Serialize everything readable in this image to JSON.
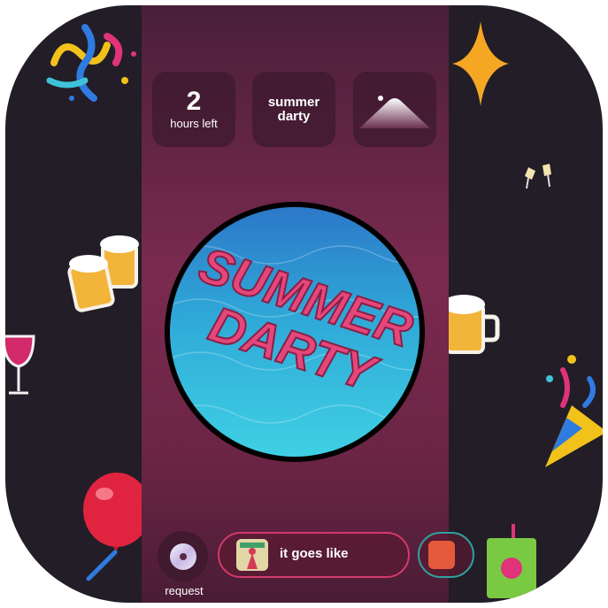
{
  "party": {
    "hours_value": "2",
    "hours_label": "hours left",
    "name": "summer darty"
  },
  "cover": {
    "line1": "SUMMER",
    "line2": "DARTY"
  },
  "bottom": {
    "request_label": "request",
    "now_playing": "it goes like"
  },
  "colors": {
    "background": "#221d27",
    "panel_top": "#4a1f3b",
    "panel_mid": "#7a2a4f",
    "pill_border": "#d23a6c",
    "next_pill_border": "#2fa3a0",
    "cover_text": "#e4477c",
    "cover_water": "#2fb8d8"
  },
  "icons": {
    "request": "disc-icon",
    "mountain": "mountain-icon",
    "decorations": [
      "confetti-icon",
      "sparkle-icon",
      "champagne-icon",
      "beer-mug-icon",
      "wine-glass-icon",
      "balloon-icon",
      "party-popper-icon",
      "juice-box-icon"
    ]
  }
}
